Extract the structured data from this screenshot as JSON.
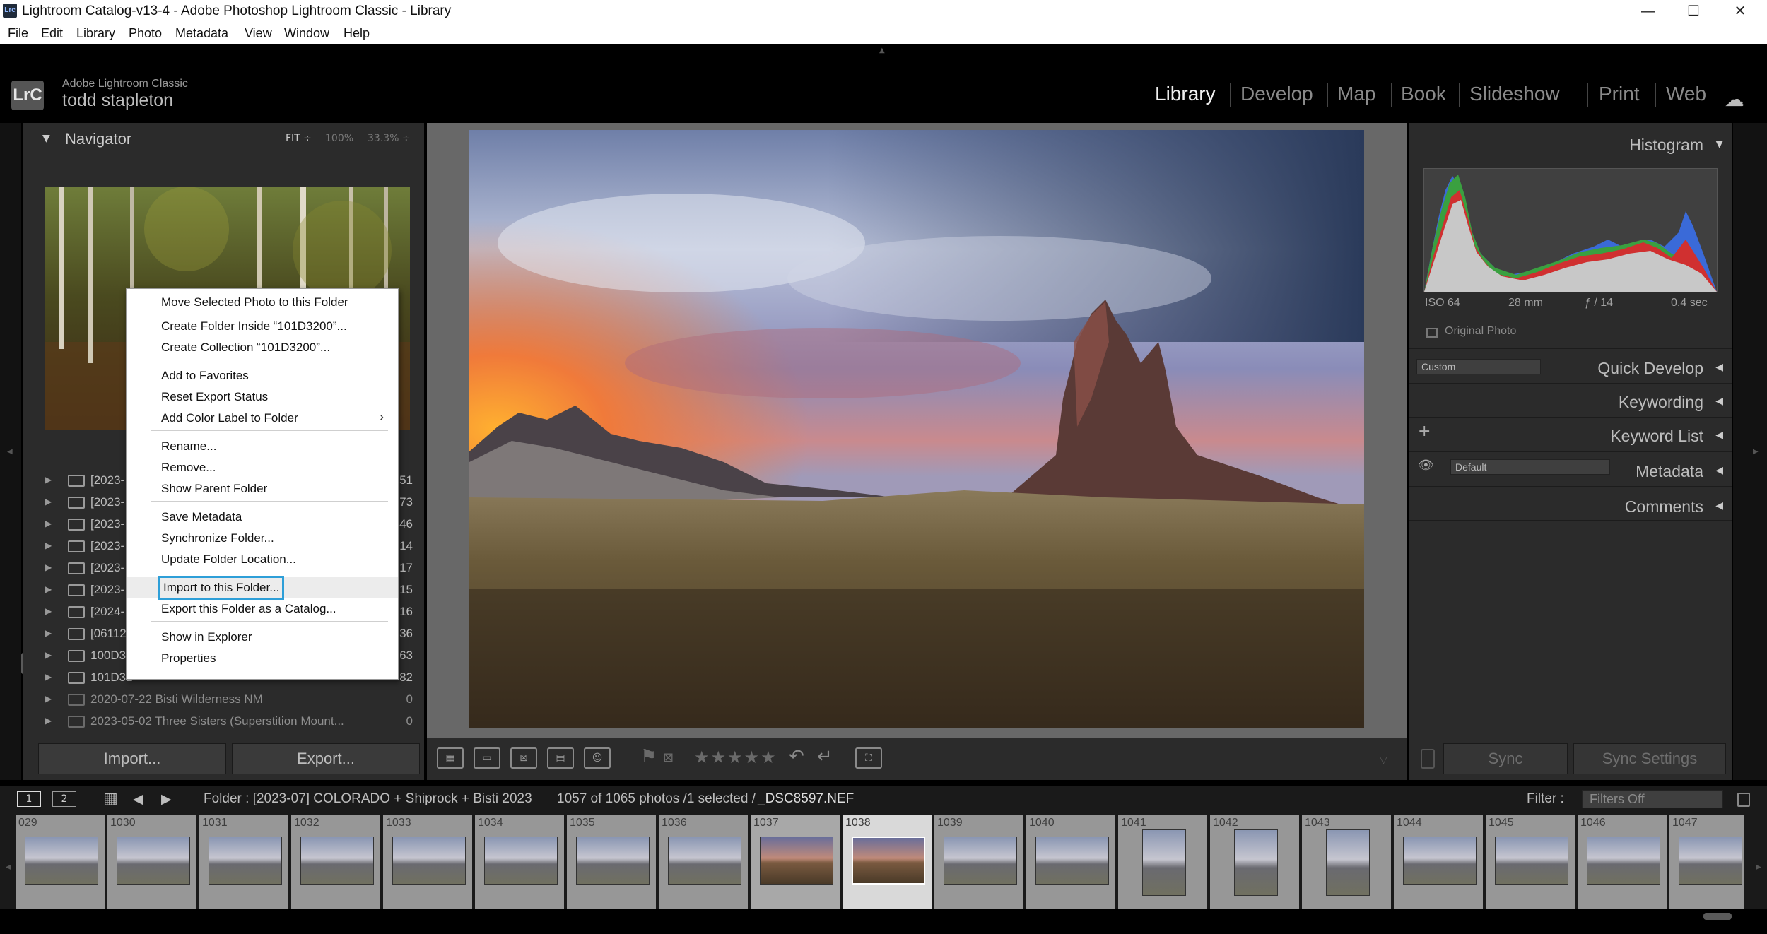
{
  "window": {
    "title": "Lightroom Catalog-v13-4 - Adobe Photoshop Lightroom Classic - Library",
    "badge": "Lrc",
    "minimize": "—",
    "maximize": "☐",
    "close": "✕"
  },
  "menubar": [
    "File",
    "Edit",
    "Library",
    "Photo",
    "Metadata",
    "View",
    "Window",
    "Help"
  ],
  "identity": {
    "logo": "LrC",
    "product": "Adobe Lightroom Classic",
    "user": "todd stapleton"
  },
  "modules": [
    "Library",
    "Develop",
    "Map",
    "Book",
    "Slideshow",
    "Print",
    "Web"
  ],
  "active_module": "Library",
  "navigator": {
    "title": "Navigator",
    "zoom_options": [
      "FIT ÷",
      "100%",
      "33.3% ÷"
    ]
  },
  "folders": [
    {
      "name": "[2023-",
      "count": "351"
    },
    {
      "name": "[2023-",
      "count": "73"
    },
    {
      "name": "[2023-",
      "count": "46"
    },
    {
      "name": "[2023-",
      "count": "14"
    },
    {
      "name": "[2023-",
      "count": "917"
    },
    {
      "name": "[2023-",
      "count": "15"
    },
    {
      "name": "[2024-",
      "count": "216"
    },
    {
      "name": "[06112",
      "count": "36"
    },
    {
      "name": "100D3",
      "count": "63"
    },
    {
      "name": "101D32",
      "count": "82"
    },
    {
      "name": "2020-07-22 Bisti Wilderness NM",
      "count": "0"
    },
    {
      "name": "2023-05-02 Three Sisters (Superstition Mount...",
      "count": "0"
    }
  ],
  "left_buttons": {
    "import": "Import...",
    "export": "Export..."
  },
  "context_menu": {
    "items": [
      {
        "label": "Move Selected Photo to this Folder"
      },
      {
        "label": "Create Folder Inside “101D3200”..."
      },
      {
        "label": "Create Collection “101D3200”..."
      },
      {
        "label": "Add to Favorites"
      },
      {
        "label": "Reset Export Status"
      },
      {
        "label": "Add Color Label to Folder",
        "sub": "›"
      },
      {
        "label": "Rename..."
      },
      {
        "label": "Remove..."
      },
      {
        "label": "Show Parent Folder"
      },
      {
        "label": "Save Metadata"
      },
      {
        "label": "Synchronize Folder..."
      },
      {
        "label": "Update Folder Location..."
      },
      {
        "label": "Import to this Folder..."
      },
      {
        "label": "Export this Folder as a Catalog..."
      },
      {
        "label": "Show in Explorer"
      },
      {
        "label": "Properties"
      }
    ]
  },
  "histogram": {
    "title": "Histogram",
    "iso": "ISO 64",
    "focal": "28 mm",
    "aperture": "ƒ / 14",
    "shutter": "0.4 sec",
    "original_photo": "Original Photo"
  },
  "right_panels": {
    "quick_develop": "Quick Develop",
    "quick_develop_preset": "Custom",
    "keywording": "Keywording",
    "keyword_list": "Keyword List",
    "add_icon": "+",
    "metadata": "Metadata",
    "metadata_preset": "Default",
    "comments": "Comments",
    "sync": "Sync",
    "sync_settings": "Sync Settings"
  },
  "filmbar": {
    "screen1": "1",
    "screen2": "2",
    "source": "Folder : [2023-07] COLORADO + Shiprock + Bisti 2023",
    "count": "1057 of 1065 photos /1 selected /",
    "filename": "_DSC8597.NEF",
    "filter_label": "Filter :",
    "filter_value": "Filters Off"
  },
  "filmstrip": [
    {
      "num": "029",
      "style": "cool"
    },
    {
      "num": "1030",
      "style": "cool"
    },
    {
      "num": "1031",
      "style": "cool"
    },
    {
      "num": "1032",
      "style": "cool"
    },
    {
      "num": "1033",
      "style": "cool"
    },
    {
      "num": "1034",
      "style": "cool"
    },
    {
      "num": "1035",
      "style": "cool"
    },
    {
      "num": "1036",
      "style": "cool"
    },
    {
      "num": "1037",
      "style": "warm"
    },
    {
      "num": "1038",
      "style": "warm"
    },
    {
      "num": "1039",
      "style": "cool"
    },
    {
      "num": "1040",
      "style": "cool"
    },
    {
      "num": "1041",
      "style": "cool"
    },
    {
      "num": "1042",
      "style": "cool"
    },
    {
      "num": "1043",
      "style": "cool"
    },
    {
      "num": "1044",
      "style": "cool"
    },
    {
      "num": "1045",
      "style": "cool"
    },
    {
      "num": "1046",
      "style": "cool"
    },
    {
      "num": "1047",
      "style": "cool"
    }
  ],
  "selected_thumb": "1038",
  "colors": {
    "accent_focus": "#2e9fd8",
    "panel_bg": "#2b2b2b",
    "center_bg": "#686868"
  }
}
